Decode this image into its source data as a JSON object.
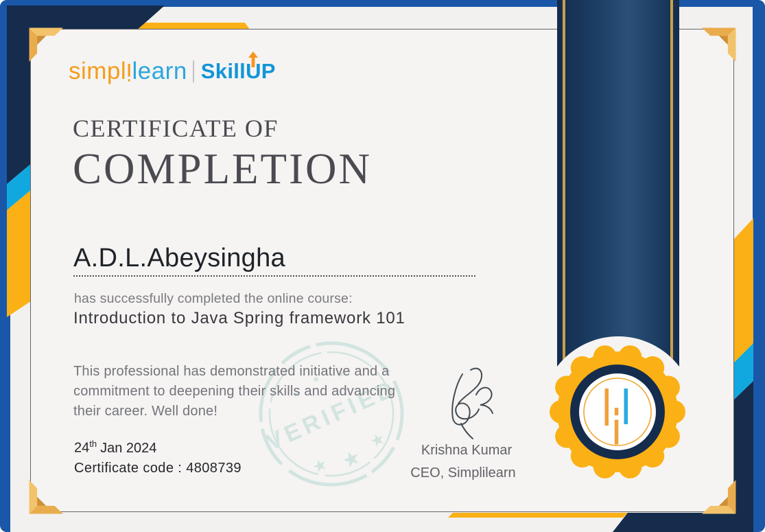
{
  "logo": {
    "brand_part1": "simpl",
    "brand_i": "i",
    "brand_part2": "learn",
    "product_pre": "Skill",
    "product_u": "U",
    "product_post": "P"
  },
  "certificate": {
    "title_line1": "CERTIFICATE OF",
    "title_line2": "COMPLETION",
    "recipient_name": "A.D.L.Abeysingha",
    "subtitle": "has successfully completed the online course:",
    "course_title": "Introduction to Java Spring framework 101",
    "description_lines": [
      "This professional has demonstrated initiative and a",
      "commitment to deepening their skills and advancing",
      "their career. Well done!"
    ],
    "date_day": "24",
    "date_suffix": "th",
    "date_rest": "Jan 2024",
    "certificate_code": "Certificate code : 4808739",
    "signer_name": "Krishna Kumar",
    "signer_title": "CEO, Simplilearn",
    "watermark_text": "VERIFIED"
  },
  "colors": {
    "frame_blue": "#1a57a8",
    "navy": "#152c4c",
    "yellow": "#fbb016",
    "cyan": "#11a8e0",
    "gold_bracket": "#e9ac4d",
    "stamp_teal": "#cfe3df",
    "logo_orange": "#f49d1d",
    "logo_blue": "#2ba6de",
    "medal_gold": "#fbb016"
  }
}
